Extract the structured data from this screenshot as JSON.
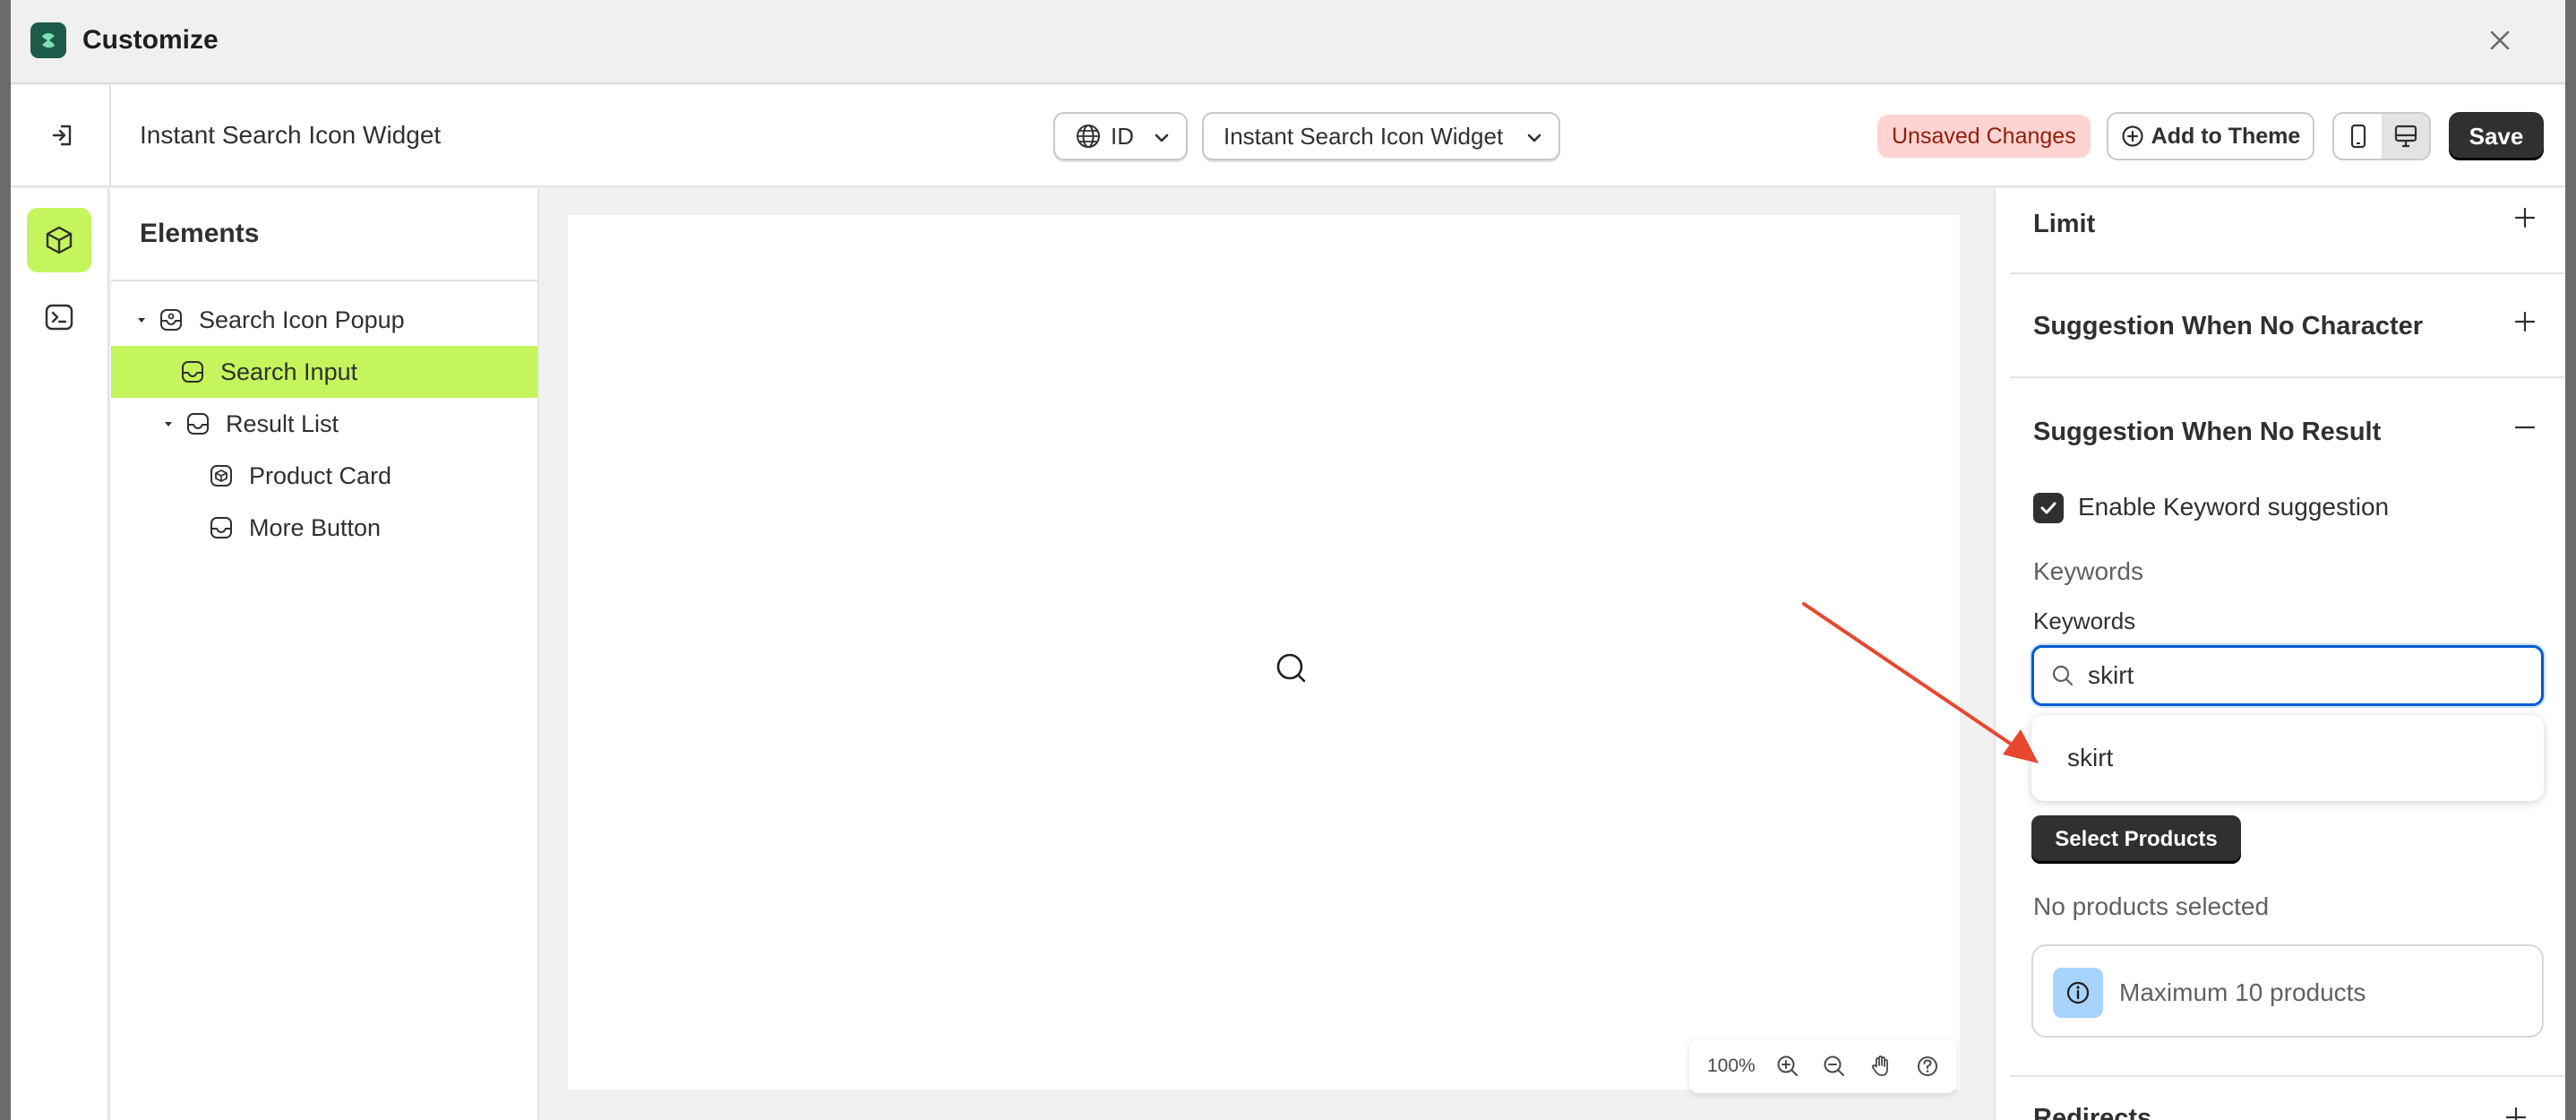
{
  "window": {
    "title": "Customize",
    "close_icon": "close-icon",
    "logo_icon": "app-logo-icon"
  },
  "toolbar": {
    "exit_icon": "exit-icon",
    "widget_title": "Instant Search Icon Widget",
    "language_select": {
      "icon": "globe-icon",
      "value": "ID"
    },
    "widget_select": {
      "value": "Instant Search Icon Widget"
    },
    "unsaved_badge": "Unsaved Changes",
    "add_to_theme": "Add to Theme",
    "view_modes": [
      "mobile-icon",
      "desktop-icon"
    ],
    "active_view": "desktop",
    "save_label": "Save"
  },
  "rail": {
    "items": [
      {
        "icon": "cube-icon",
        "active": true
      },
      {
        "icon": "terminal-icon",
        "active": false
      }
    ]
  },
  "elements_panel": {
    "title": "Elements",
    "tree": [
      {
        "label": "Search Icon Popup",
        "expanded": true,
        "selected": false
      },
      {
        "label": "Search Input",
        "selected": true
      },
      {
        "label": "Result List",
        "expanded": true,
        "selected": false
      },
      {
        "label": "Product Card",
        "selected": false
      },
      {
        "label": "More Button",
        "selected": false
      }
    ]
  },
  "canvas": {
    "zoom": "100%",
    "tools": [
      "zoom-in-icon",
      "zoom-out-icon",
      "hand-icon",
      "help-icon"
    ]
  },
  "settings": {
    "sections": {
      "limit": "Limit",
      "no_character": "Suggestion When No Character",
      "no_result": "Suggestion When No Result",
      "redirects": "Redirects"
    },
    "enable_keyword_label": "Enable Keyword suggestion",
    "enable_keyword_checked": true,
    "keywords_heading": "Keywords",
    "keywords_field_label": "Keywords",
    "keywords_input_value": "skirt",
    "dropdown_option": "skirt",
    "select_products": "Select Products",
    "no_products": "No products selected",
    "max_info": "Maximum 10 products"
  },
  "colors": {
    "accent_green": "#c4f55c",
    "focus_blue": "#005bd3",
    "unsaved_bg": "#fed3d1",
    "annotation_arrow": "#e8472f"
  }
}
